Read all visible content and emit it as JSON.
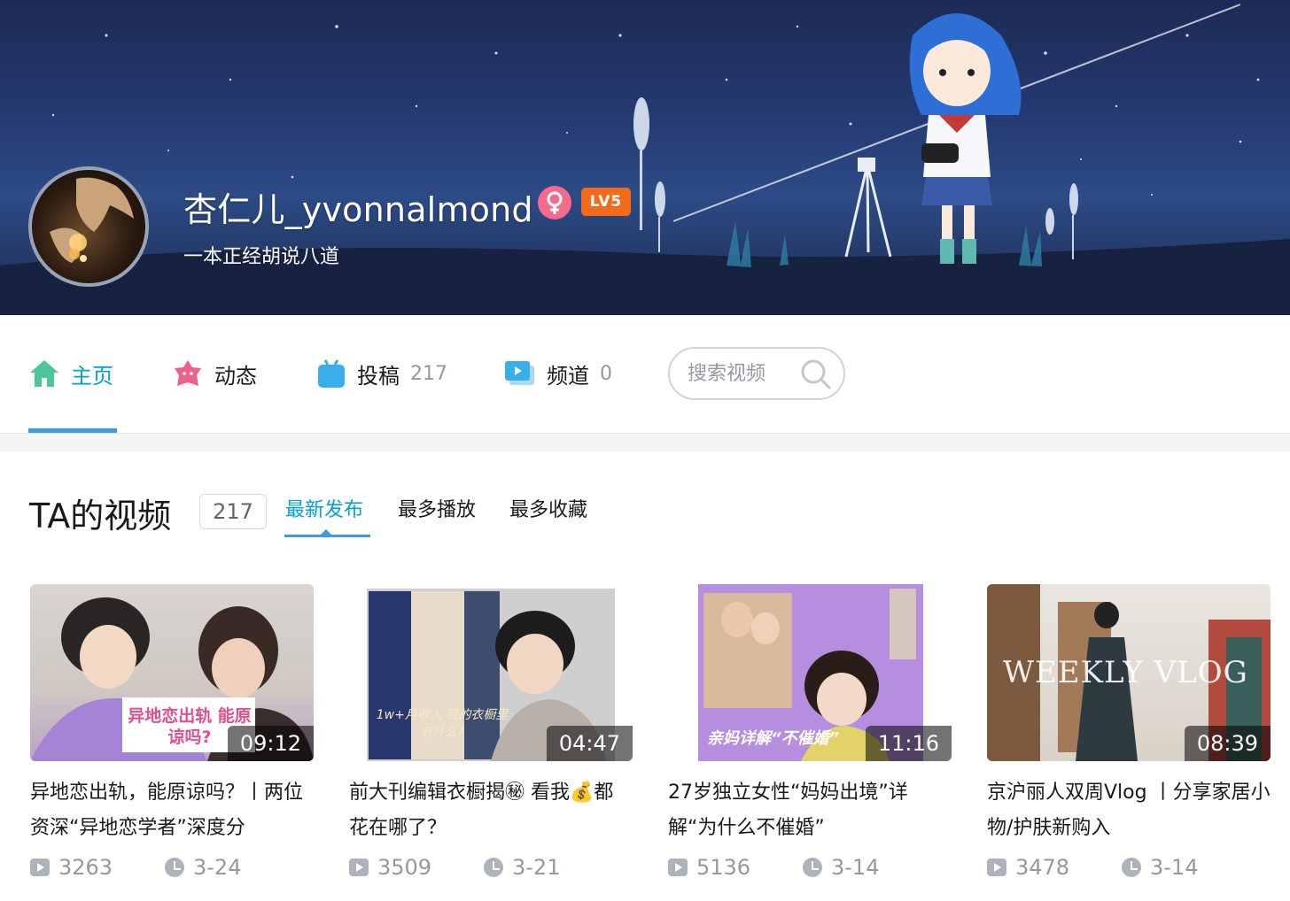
{
  "profile": {
    "name": "杏仁儿_yvonnalmond",
    "level": "LV5",
    "sign": "一本正经胡说八道",
    "gender_icon": "female-icon"
  },
  "nav": {
    "items": [
      {
        "label": "主页",
        "count": "",
        "icon": "home-icon",
        "active": true
      },
      {
        "label": "动态",
        "count": "",
        "icon": "dynamic-icon"
      },
      {
        "label": "投稿",
        "count": "217",
        "icon": "upload-icon"
      },
      {
        "label": "频道",
        "count": "0",
        "icon": "channel-icon"
      }
    ],
    "search_placeholder": "搜索视频"
  },
  "videos_section": {
    "title": "TA的视频",
    "count": "217",
    "sort_tabs": [
      "最新发布",
      "最多播放",
      "最多收藏"
    ],
    "active_sort": "最新发布"
  },
  "videos": [
    {
      "title": "异地恋出轨，能原谅吗？丨两位资深“异地恋学者”深度分",
      "duration": "09:12",
      "plays": "3263",
      "date": "3-24",
      "thumb_text": "异地恋出轨 能原谅吗?"
    },
    {
      "title": "前大刊编辑衣橱揭㊙ 看我💰都花在哪了？",
      "duration": "04:47",
      "plays": "3509",
      "date": "3-21",
      "thumb_text": "1w+月收入 我的衣橱里有什么?"
    },
    {
      "title": "27岁独立女性“妈妈出境”详解“为什么不催婚”",
      "duration": "11:16",
      "plays": "5136",
      "date": "3-14",
      "thumb_text": "亲妈详解“不催婚”"
    },
    {
      "title": "京沪丽人双周Vlog 丨分享家居小物/护肤新购入",
      "duration": "08:39",
      "plays": "3478",
      "date": "3-14",
      "thumb_text": "WEEKLY VLOG"
    }
  ],
  "colors": {
    "accent": "#00a1d6",
    "underline": "#3b9ae1",
    "gender": "#f56b8d",
    "level": "#f26b1d"
  }
}
